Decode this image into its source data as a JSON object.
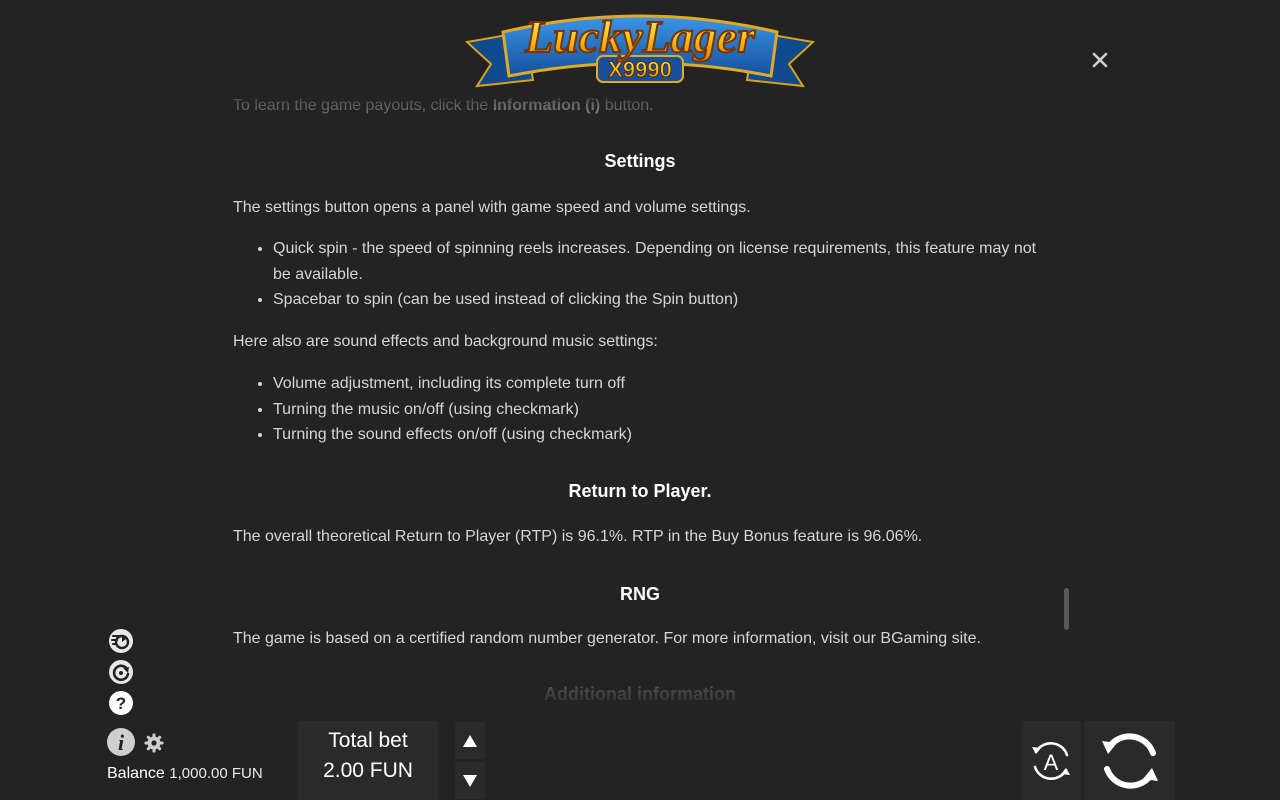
{
  "logo": {
    "title": "LuckyLager",
    "subtitle": "X9990"
  },
  "content": {
    "top_line_prefix": "To learn the game payouts, click the ",
    "top_line_bold": "Information (i)",
    "top_line_suffix": " button.",
    "settings": {
      "heading": "Settings",
      "intro": "The settings button opens a panel with game speed and volume settings.",
      "items": [
        "Quick spin - the speed of spinning reels increases. Depending on license requirements, this feature may not be available.",
        "Spacebar to spin (can be used instead of clicking the Spin button)"
      ],
      "sound_intro": "Here also are sound effects and background music settings:",
      "sound_items": [
        "Volume adjustment, including its complete turn off",
        "Turning the music on/off (using checkmark)",
        "Turning the sound effects on/off (using checkmark)"
      ]
    },
    "rtp": {
      "heading": "Return to Player.",
      "text": "The overall theoretical Return to Player (RTP) is 96.1%. RTP in the Buy Bonus feature is 96.06%."
    },
    "rng": {
      "heading": "RNG",
      "text": "The game is based on a certified random number generator. For more information, visit our BGaming site."
    },
    "next_heading": "Additional information"
  },
  "footer": {
    "balance_label": "Balance",
    "balance_value": "1,000.00 FUN",
    "total_bet_label": "Total bet",
    "total_bet_value": "2.00 FUN"
  },
  "icons": {
    "quick_spin": "quick-spin-icon",
    "autoplay_side": "autoplay-icon",
    "help": "help-icon",
    "info": "info-icon",
    "settings": "gear-icon",
    "bet_up": "arrow-up-icon",
    "bet_down": "arrow-down-icon",
    "auto": "auto-spin-icon",
    "spin": "spin-icon",
    "close": "close-icon"
  },
  "colors": {
    "background": "#232323",
    "text": "#d6d6d6",
    "heading": "#ffffff",
    "panel": "#2a2a2a",
    "logo_gold": "#f7c520",
    "logo_banner": "#1f6fc4"
  }
}
